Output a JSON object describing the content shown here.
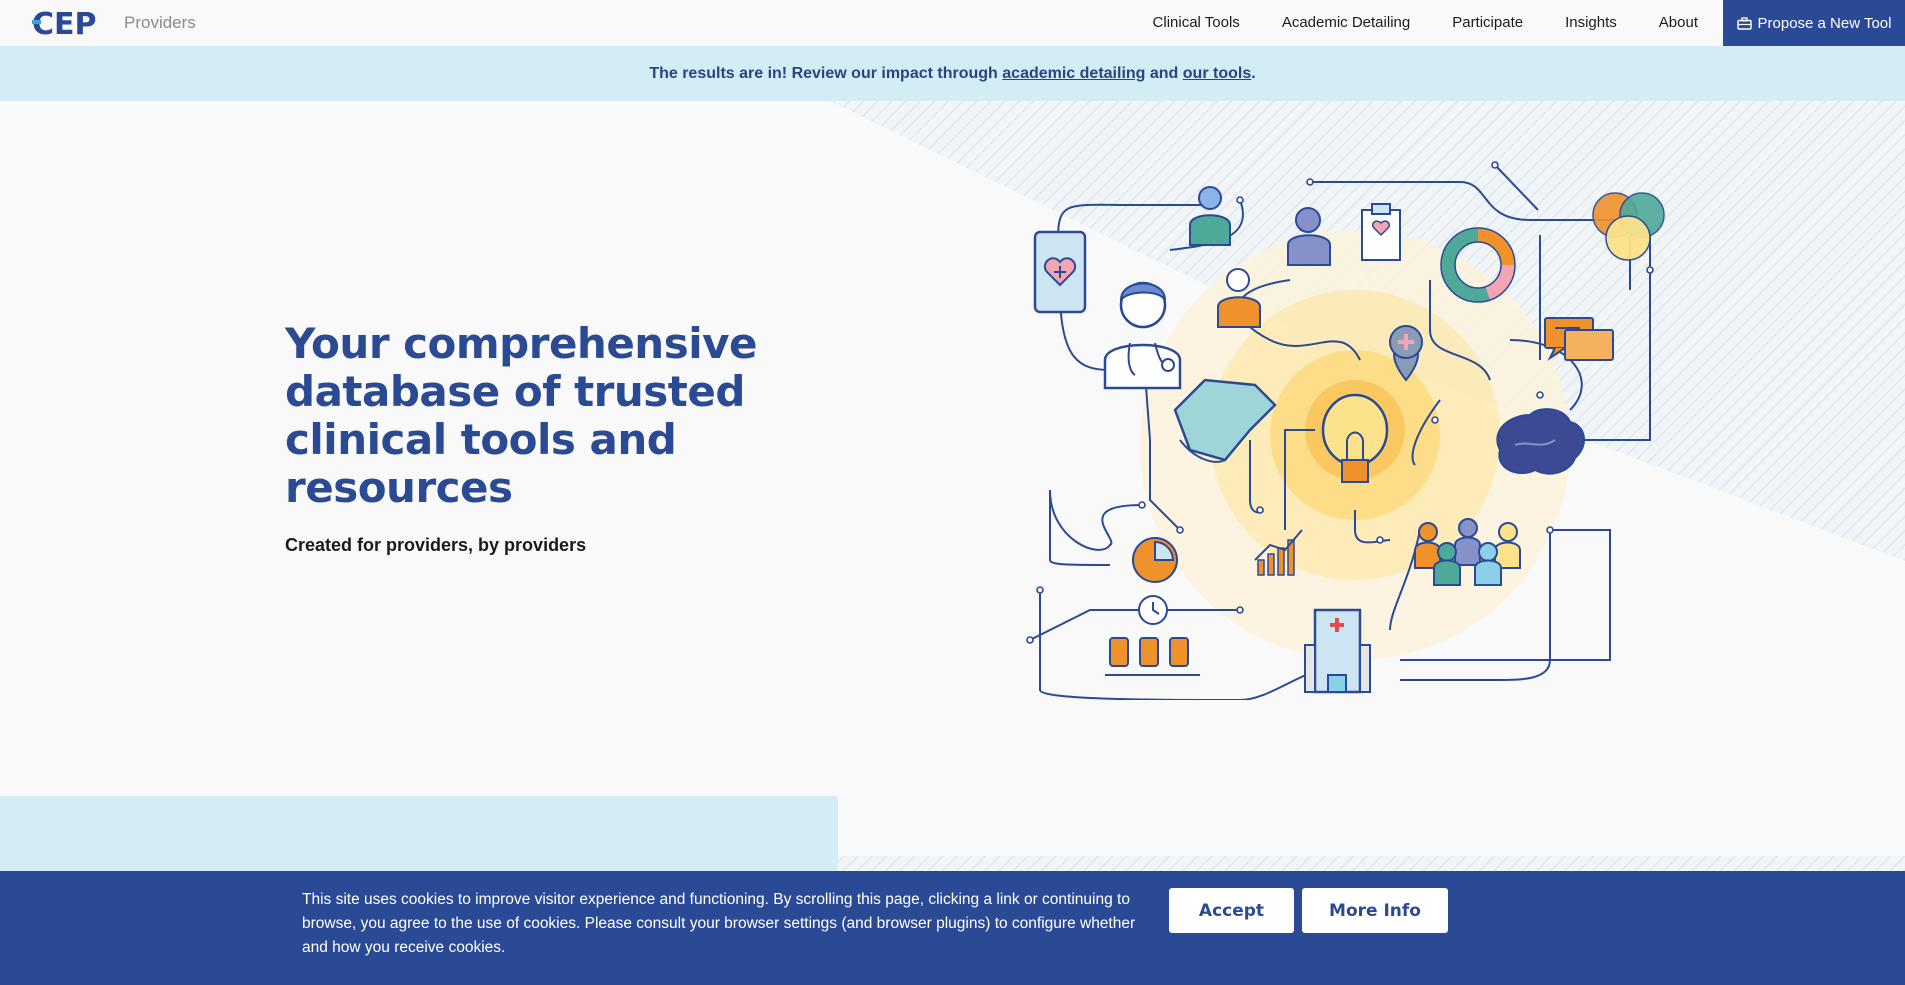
{
  "nav": {
    "logo_text": "CEP",
    "site_name": "Providers",
    "links": [
      "Clinical Tools",
      "Academic Detailing",
      "Participate",
      "Insights",
      "About"
    ],
    "propose_label": "Propose a New Tool",
    "propose_icon": "toolbox-icon"
  },
  "banner": {
    "prefix": "The results are in! Review our impact through ",
    "link1": "academic detailing",
    "middle": " and ",
    "link2": "our tools",
    "suffix": "."
  },
  "hero": {
    "title": "Your comprehensive database of trusted clinical tools and resources",
    "subtitle": "Created for providers, by providers"
  },
  "cookie": {
    "text": "This site uses cookies to improve visitor experience and functioning. By scrolling this page, clicking a link or continuing to browse, you agree to the use of cookies. Please consult your browser settings (and browser plugins) to configure whether and how you receive cookies.",
    "accept_label": "Accept",
    "more_label": "More Info"
  },
  "colors": {
    "brand_blue": "#2b4a96",
    "banner_bg": "#d3edf5",
    "logo_cyan": "#3aa3d8",
    "accent_orange": "#f0922b",
    "accent_teal": "#4fa999",
    "accent_yellow": "#fce28a"
  }
}
